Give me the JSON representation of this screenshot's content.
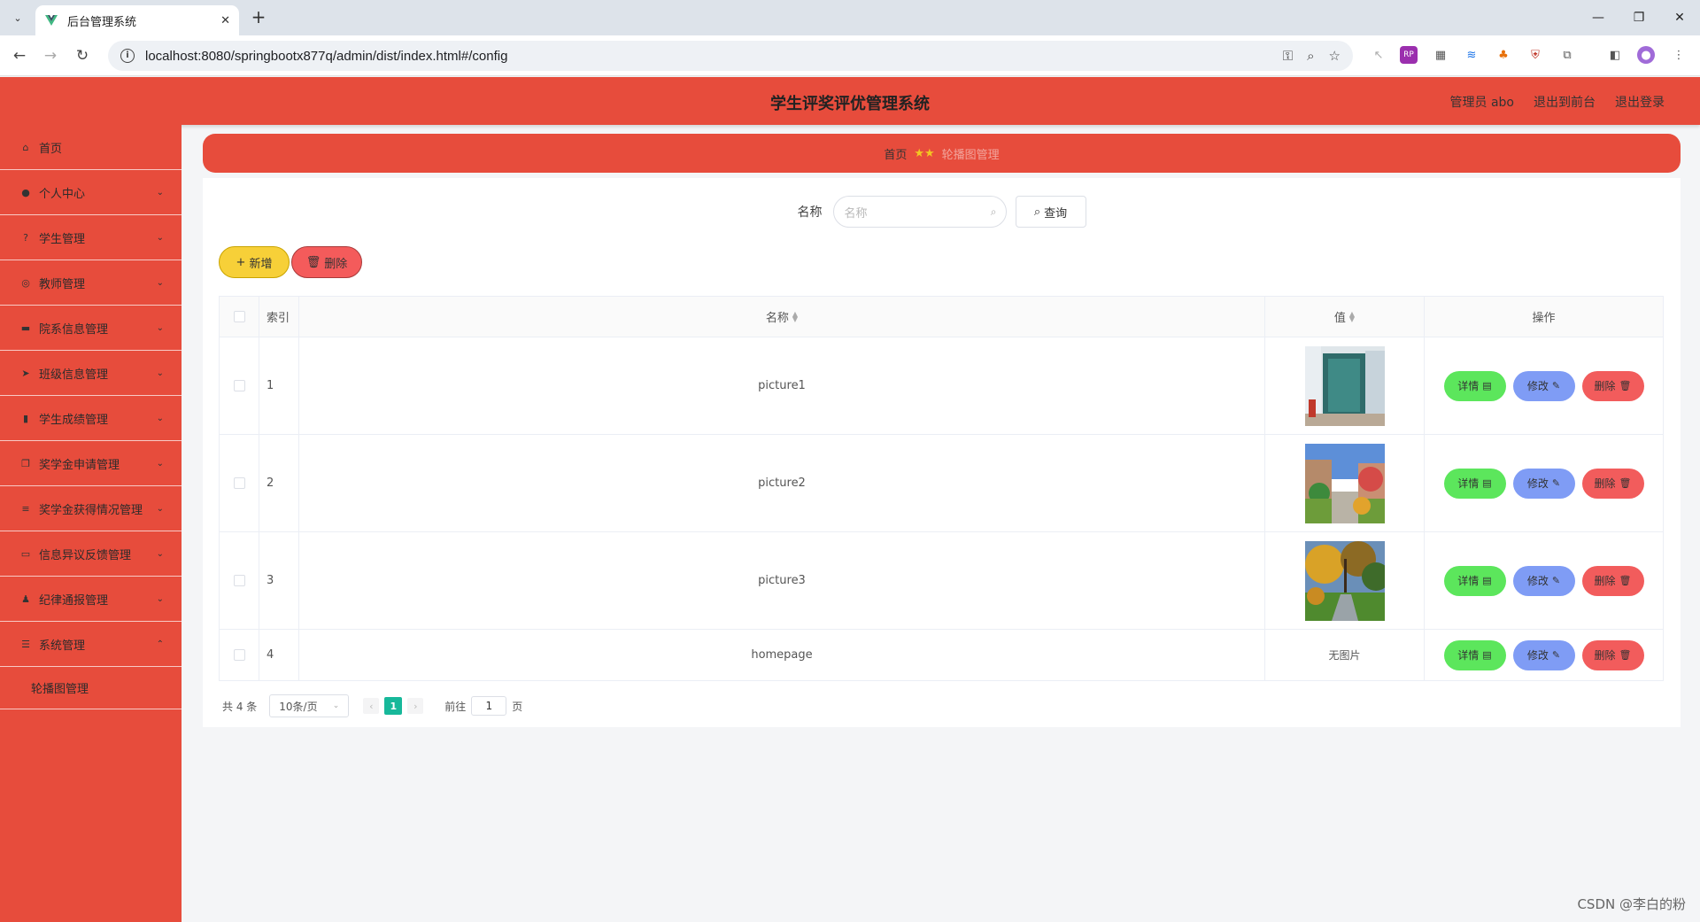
{
  "browser": {
    "tab_title": "后台管理系统",
    "url": "localhost:8080/springbootx877q/admin/dist/index.html#/config"
  },
  "header": {
    "title": "学生评奖评优管理系统",
    "user": "管理员 abo",
    "to_front": "退出到前台",
    "logout": "退出登录"
  },
  "sidebar": {
    "items": [
      {
        "label": "首页",
        "icon": "home-icon"
      },
      {
        "label": "个人中心",
        "icon": "user-icon"
      },
      {
        "label": "学生管理",
        "icon": "help-icon"
      },
      {
        "label": "教师管理",
        "icon": "compass-icon"
      },
      {
        "label": "院系信息管理",
        "icon": "suitcase-icon"
      },
      {
        "label": "班级信息管理",
        "icon": "send-icon"
      },
      {
        "label": "学生成绩管理",
        "icon": "chart-icon"
      },
      {
        "label": "奖学金申请管理",
        "icon": "copy-icon"
      },
      {
        "label": "奖学金获得情况管理",
        "icon": "list-icon"
      },
      {
        "label": "信息异议反馈管理",
        "icon": "message-icon"
      },
      {
        "label": "纪律通报管理",
        "icon": "person-icon"
      },
      {
        "label": "系统管理",
        "icon": "setting-icon"
      }
    ],
    "sub_item": "轮播图管理"
  },
  "breadcrumb": {
    "home": "首页",
    "current": "轮播图管理"
  },
  "search": {
    "label": "名称",
    "placeholder": "名称",
    "button": "查询"
  },
  "actions": {
    "add": "新增",
    "delete": "删除"
  },
  "table": {
    "headers": {
      "index": "索引",
      "name": "名称",
      "value": "值",
      "ops": "操作"
    },
    "rows": [
      {
        "index": "1",
        "name": "picture1",
        "has_image": true,
        "value_text": ""
      },
      {
        "index": "2",
        "name": "picture2",
        "has_image": true,
        "value_text": ""
      },
      {
        "index": "3",
        "name": "picture3",
        "has_image": true,
        "value_text": ""
      },
      {
        "index": "4",
        "name": "homepage",
        "has_image": false,
        "value_text": "无图片"
      }
    ],
    "ops": {
      "detail": "详情",
      "edit": "修改",
      "delete": "删除"
    }
  },
  "pager": {
    "total": "共 4 条",
    "page_size": "10条/页",
    "current_page": "1",
    "goto_label": "前往",
    "goto_value": "1",
    "page_suffix": "页"
  },
  "watermark": "CSDN @李白的粉",
  "colors": {
    "primary": "#e74c3c",
    "add": "#f7d038",
    "detail": "#5ce65c",
    "edit": "#7f9cf5",
    "danger": "#f25c5c",
    "page_active": "#17b89a"
  }
}
